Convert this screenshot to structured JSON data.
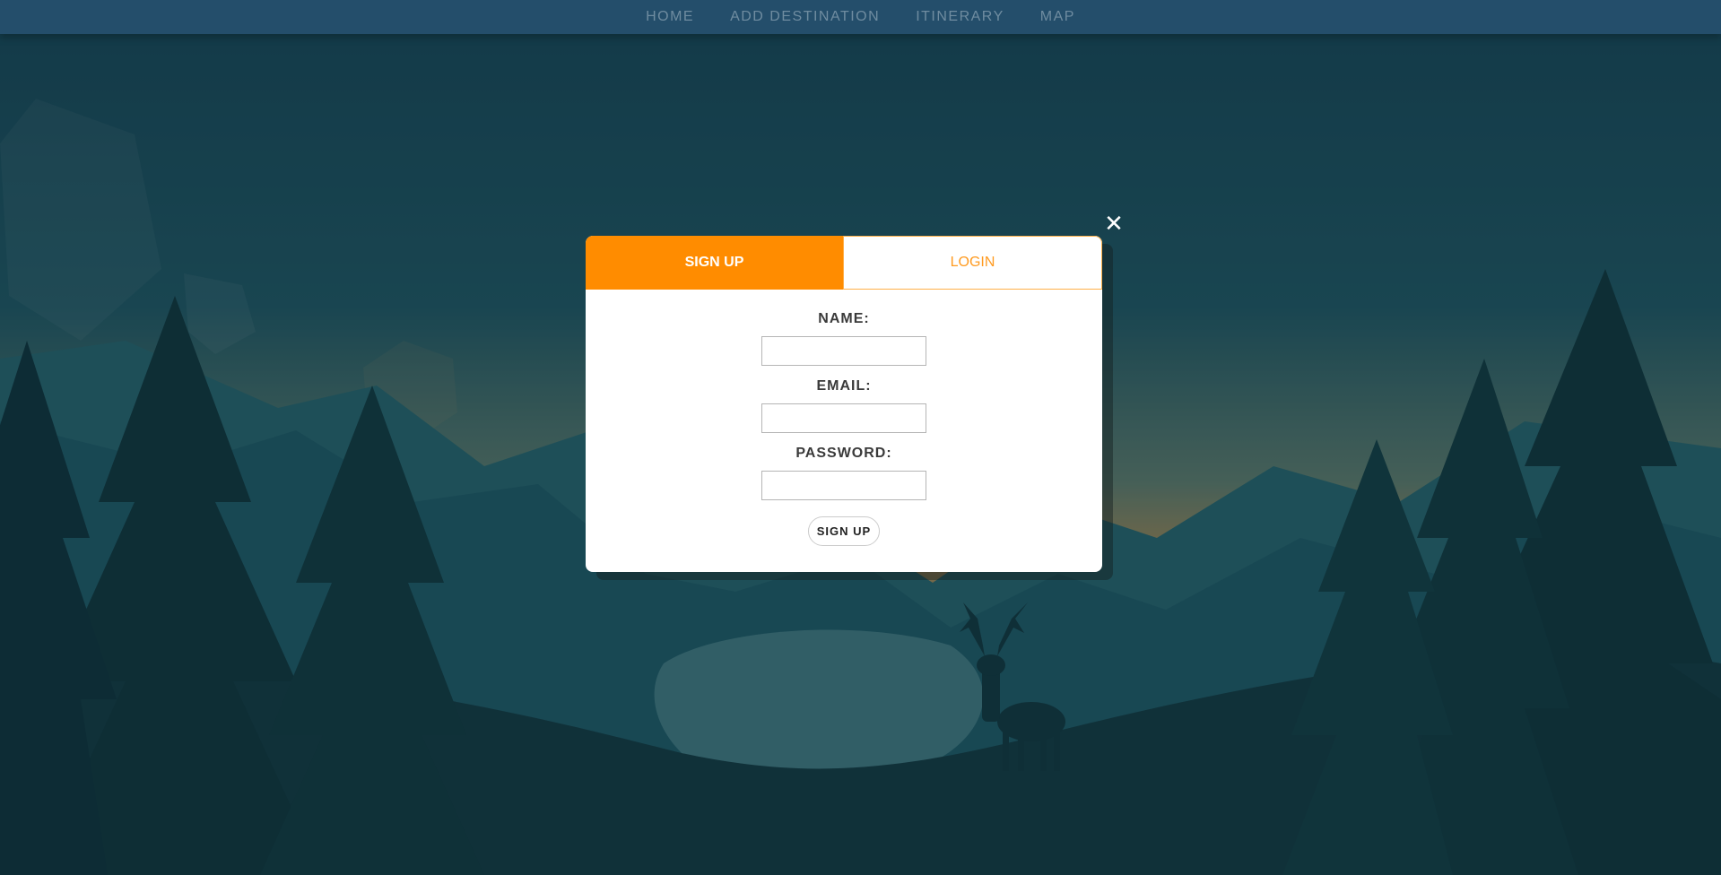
{
  "nav": {
    "items": [
      {
        "label": "HOME"
      },
      {
        "label": "ADD DESTINATION"
      },
      {
        "label": "ITINERARY"
      },
      {
        "label": "MAP"
      }
    ]
  },
  "modal": {
    "close_icon": "close-icon",
    "close_glyph": "✕",
    "tabs": {
      "signup_label": "SIGN UP",
      "login_label": "LOGIN"
    },
    "form": {
      "name_label": "NAME:",
      "name_value": "",
      "email_label": "EMAIL:",
      "email_value": "",
      "password_label": "PASSWORD:",
      "password_value": "",
      "submit_label": "SIGN UP"
    }
  },
  "colors": {
    "accent": "#ff8c00",
    "nav_bg": "#244e6b",
    "nav_text": "#6f8ca0",
    "background_sky": "#1f5866",
    "background_sunset": "#c49a5a"
  },
  "background": {
    "icon": "deer-landscape-illustration"
  }
}
